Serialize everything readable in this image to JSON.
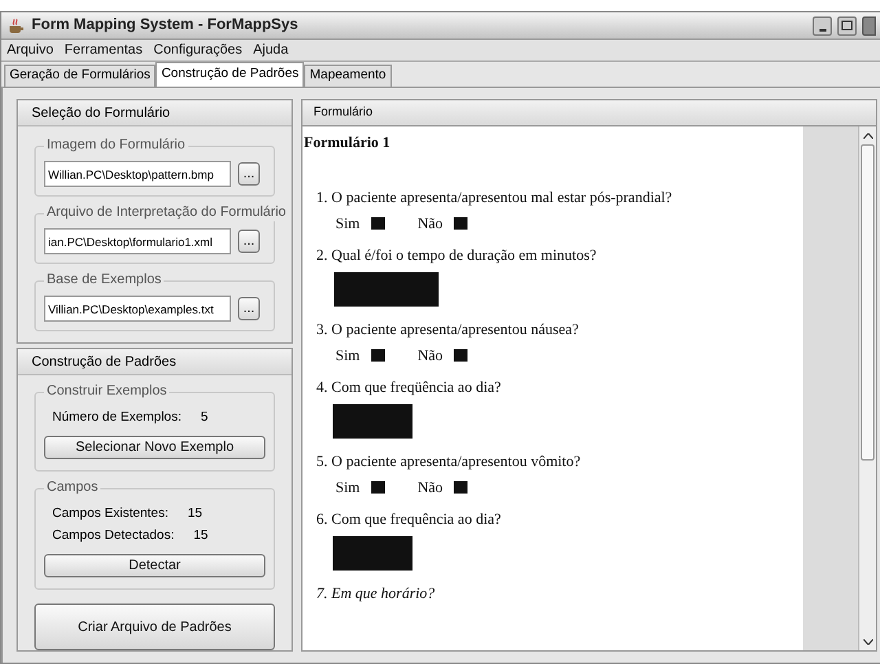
{
  "window": {
    "title": "Form Mapping System - ForMappSys"
  },
  "menu": [
    "Arquivo",
    "Ferramentas",
    "Configurações",
    "Ajuda"
  ],
  "tabs": [
    {
      "label": "Geração de Formulários",
      "selected": false
    },
    {
      "label": "Construção de Padrões",
      "selected": true
    },
    {
      "label": "Mapeamento",
      "selected": false
    }
  ],
  "selection_panel": {
    "title": "Seleção do Formulário",
    "groups": [
      {
        "title": "Imagem do Formulário",
        "value": "Willian.PC\\Desktop\\pattern.bmp",
        "button": "..."
      },
      {
        "title": "Arquivo de Interpretação do Formulário",
        "value": "ian.PC\\Desktop\\formulario1.xml",
        "button": "..."
      },
      {
        "title": "Base de Exemplos",
        "value": "Villian.PC\\Desktop\\examples.txt",
        "button": "..."
      }
    ]
  },
  "patterns_panel": {
    "title": "Construção de Padrões",
    "examples_group": {
      "title": "Construir Exemplos",
      "rows": [
        {
          "label": "Número de Exemplos:",
          "value": "5"
        }
      ],
      "button": "Selecionar Novo Exemplo"
    },
    "fields_group": {
      "title": "Campos",
      "rows": [
        {
          "label": "Campos Existentes:",
          "value": "15"
        },
        {
          "label": "Campos Detectados:",
          "value": "15"
        }
      ],
      "button": "Detectar"
    },
    "create_button": "Criar Arquivo de Padrões"
  },
  "form_panel": {
    "title": "Formulário",
    "document_title": "Formulário 1",
    "questions": [
      {
        "text": "1. O paciente apresenta/apresentou mal estar pós-prandial?",
        "kind": "choice",
        "options": [
          "Sim",
          "Não"
        ],
        "italic": false
      },
      {
        "text": "2. Qual é/foi o tempo de duração em minutos?",
        "kind": "wide_box",
        "italic": false
      },
      {
        "text": "3. O paciente apresenta/apresentou náusea?",
        "kind": "choice",
        "options": [
          "Sim",
          "Não"
        ],
        "italic": false
      },
      {
        "text": "4. Com que freqüência ao dia?",
        "kind": "box",
        "italic": false
      },
      {
        "text": "5. O paciente apresenta/apresentou vômito?",
        "kind": "choice",
        "options": [
          "Sim",
          "Não"
        ],
        "italic": false
      },
      {
        "text": "6. Com que frequência ao dia?",
        "kind": "box",
        "italic": false
      },
      {
        "text": "7. Em que horário?",
        "kind": "text",
        "italic": true
      }
    ]
  }
}
